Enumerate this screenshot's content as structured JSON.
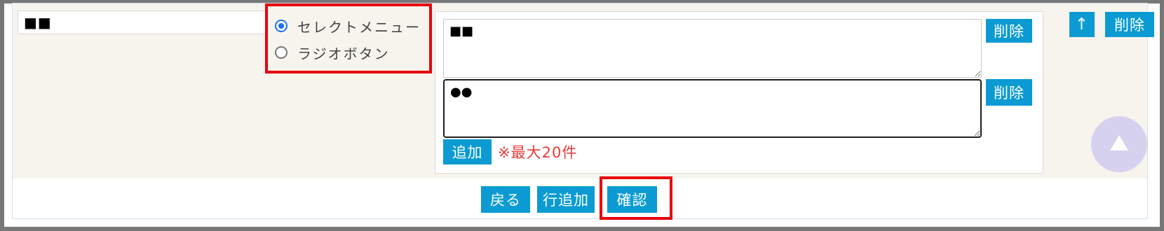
{
  "row": {
    "name_value": "■■",
    "type_options": [
      {
        "label": "セレクトメニュー",
        "selected": true
      },
      {
        "label": "ラジオボタン",
        "selected": false
      }
    ],
    "options": [
      {
        "value": "■■",
        "delete_label": "削除"
      },
      {
        "value": "●●",
        "delete_label": "削除"
      }
    ],
    "add_label": "追加",
    "max_note": "※最大20件",
    "move_up_label": "↑",
    "row_delete_label": "削除"
  },
  "footer": {
    "back_label": "戻る",
    "add_row_label": "行追加",
    "confirm_label": "確認"
  },
  "icons": {
    "scroll_top": "triangle-up-icon"
  },
  "colors": {
    "button": "#0b9bd2",
    "note": "#e83b3b",
    "highlight": "#e8000b",
    "radio_selected": "#1a73e8",
    "scroll_top_bg": "#d6d1ee"
  }
}
